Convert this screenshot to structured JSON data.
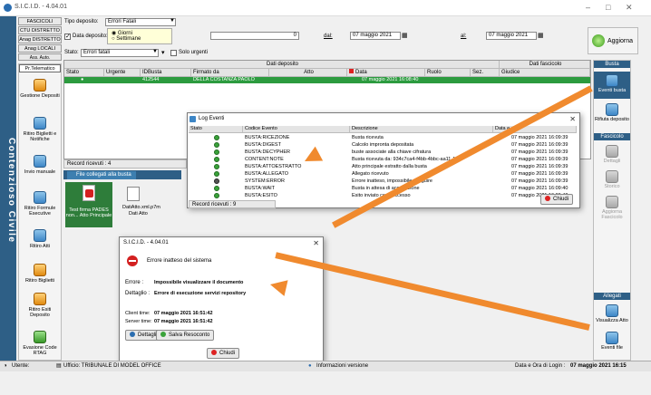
{
  "window": {
    "title": "S.I.C.I.D. - 4.04.01",
    "min": "–",
    "max": "□",
    "close": "✕"
  },
  "sidebar_vertical": "Contenzioso Civile",
  "nav": {
    "tabs": [
      "FASCICOLI",
      "CTU DISTRETTO",
      "Anag DISTRETTO",
      "Anag LOCALI",
      "Ass. Auto.",
      "Pr.Telematico"
    ]
  },
  "filters": {
    "tipo_deposito_label": "Tipo deposito:",
    "tipo_deposito_value": "Errori Fatali",
    "data_deposito_label": "Data deposito:",
    "radio_giorni": "Giorni",
    "radio_settimane": "Settimane",
    "days_value": "0",
    "dal_label": "dal:",
    "dal_value": "07 maggio 2021",
    "al_label": "al:",
    "al_value": "07 maggio 2021",
    "stato_label": "Stato:",
    "stato_value": "Errori fatali",
    "solo_urgenti_label": "Solo urgenti",
    "aggiorna_label": "Aggiorna"
  },
  "grid": {
    "group_headers": [
      "Dati deposito",
      "Dati fascicolo"
    ],
    "columns": [
      "Stato",
      "Urgente",
      "IDBusta",
      "Firmato da",
      "Atto",
      "Data",
      "Ruolo",
      "Sez.",
      "Giudice"
    ],
    "rows": [
      {
        "idbusta": "412544",
        "firmato_da": "DELLA COSTANZA PAOLO",
        "data": "07 maggio 2021 16:08:40"
      }
    ],
    "records": "Record ricevuti : 4"
  },
  "left_panel": [
    "Gestione Depositi",
    "Ritiro Biglietti e Notifiche",
    "Invio manuale",
    "Ritiro Formule Esecutive",
    "Ritiro Atti",
    "Ritiro Biglietti",
    "Ritiro Esiti Deposito",
    "Evasione Code RTAG"
  ],
  "files": {
    "tab": "File collegati alla busta",
    "file1": "Test firma PADES non... Atto Principale",
    "file2_name": "DatiAtto.xml.p7m",
    "file2_type": "Dati Atto"
  },
  "right_panel": {
    "busta_header": "Busta",
    "eventi_busta": "Eventi busta",
    "rifiuta": "Rifiuta deposito",
    "fascicolo_header": "Fascicolo",
    "dettagli": "Dettagli",
    "storico": "Storico",
    "aggiorna_fasc": "Aggiorna Fascicolo",
    "allegati_header": "Allegati",
    "visualizza_atto": "Visualizza Atto",
    "eventi_file": "Eventi file"
  },
  "log": {
    "title": "Log Eventi",
    "columns": [
      "Stato",
      "Codice Evento",
      "Descrizione",
      "Data e ora"
    ],
    "rows": [
      {
        "code": "BUSTA:RICEZIONE",
        "desc": "Busta ricevuta",
        "date": "07 maggio 2021 16:09:39",
        "err": false
      },
      {
        "code": "BUSTA:DIGEST",
        "desc": "Calcolo impronta depositata",
        "date": "07 maggio 2021 16:09:39",
        "err": false
      },
      {
        "code": "BUSTA:DECYPHER",
        "desc": "buste associate alla chiave cifratura",
        "date": "07 maggio 2021 16:09:39",
        "err": false
      },
      {
        "code": "CONTENT:NOTE",
        "desc": "Busta ricevuta da: 934c7ca4-f4bb-4bbc-aa11-1...",
        "date": "07 maggio 2021 16:09:39",
        "err": false
      },
      {
        "code": "BUSTA:ATTOESTRATTO",
        "desc": "Atto principale estratto dalla busta",
        "date": "07 maggio 2021 16:09:39",
        "err": false
      },
      {
        "code": "BUSTA:ALLEGATO",
        "desc": "Allegato ricevuto",
        "date": "07 maggio 2021 16:09:39",
        "err": false
      },
      {
        "code": "SYSTEM:ERROR",
        "desc": "Errore inatteso, impossibile eseguire",
        "date": "07 maggio 2021 16:09:39",
        "err": true
      },
      {
        "code": "BUSTA:WAIT",
        "desc": "Busta in attesa di accettazione",
        "date": "07 maggio 2021 16:09:40",
        "err": false
      },
      {
        "code": "BUSTA:ESITO",
        "desc": "Esito inviato con successo",
        "date": "07 maggio 2021 16:09:40",
        "err": false
      }
    ],
    "records": "Record ricevuti : 9",
    "chiudi": "Chiudi"
  },
  "error_dialog": {
    "title": "S.I.C.I.D. - 4.04.01",
    "heading": "Errore inatteso del sistema",
    "errore_label": "Errore :",
    "errore_value": "Impossibile visualizzare il documento",
    "dettaglio_label": "Dettaglio :",
    "dettaglio_value": "Errore di esecuzione servizi repository",
    "client_label": "Client time:",
    "client_value": "07 maggio 2021 16:51:42",
    "server_label": "Server time:",
    "server_value": "07 maggio 2021 16:51:42",
    "dettagli_btn": "Dettagli",
    "salva_btn": "Salva Resoconto",
    "chiudi_btn": "Chiudi"
  },
  "statusbar": {
    "utente": "Utente:",
    "ufficio": "Ufficio: TRIBUNALE DI MODEL OFFICE",
    "info": "Informazioni versione",
    "login_label": "Data e Ora di Login :",
    "login_value": "07 maggio 2021 16:15"
  },
  "colors": {
    "accent_blue": "#2e5f86",
    "selected_row": "#2c9b3f",
    "arrow": "#f08a2e"
  }
}
